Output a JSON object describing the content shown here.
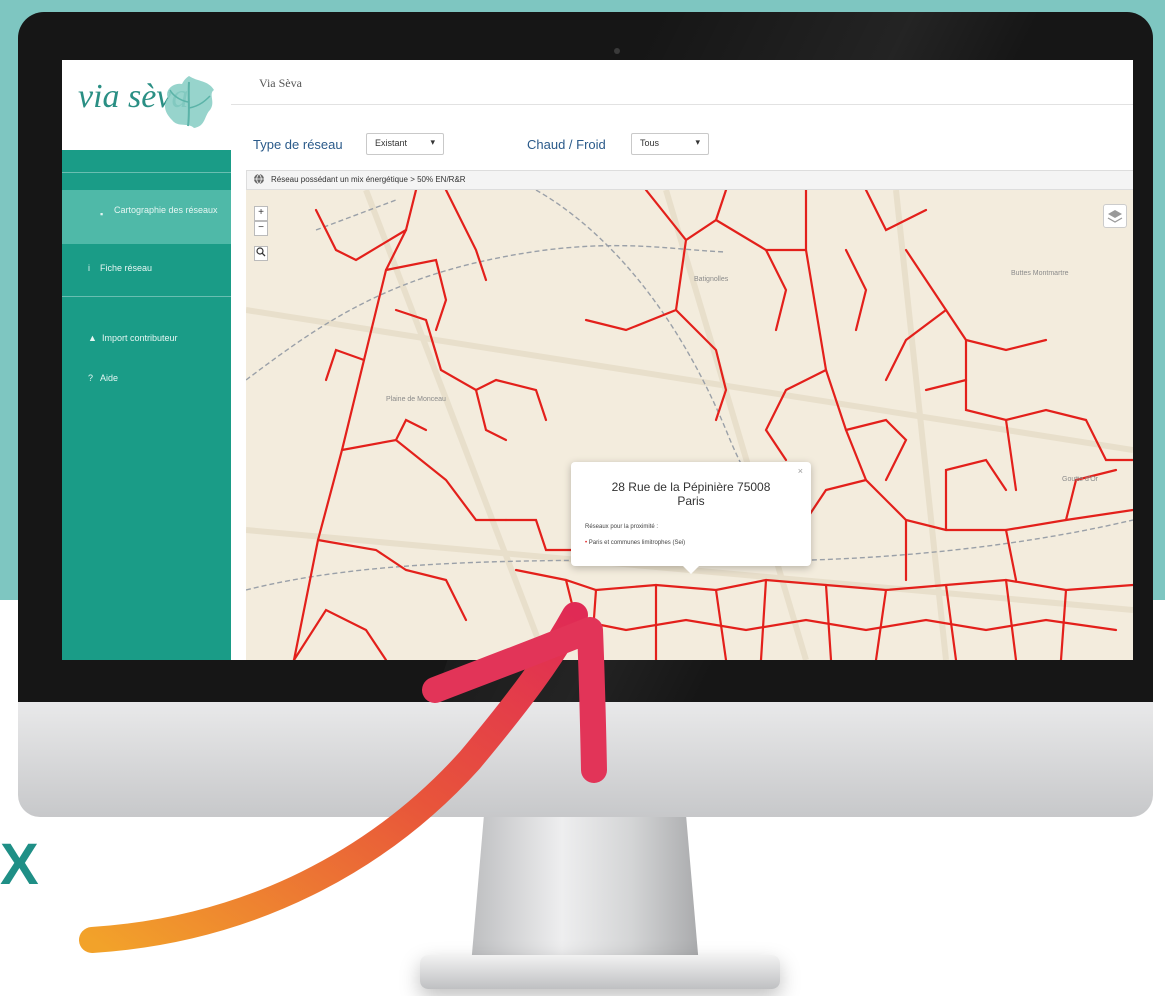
{
  "app": {
    "logo_text": "via sèva",
    "title": "Via Sèva"
  },
  "sidebar": {
    "items": [
      {
        "label": "Cartographie des réseaux",
        "icon": "map-icon",
        "active": true
      },
      {
        "label": "Fiche réseau",
        "icon": "info-icon"
      },
      {
        "label": "Import contributeur",
        "icon": "user-icon"
      },
      {
        "label": "Aide",
        "icon": "help-icon"
      }
    ]
  },
  "filters": {
    "type_label": "Type de réseau",
    "type_value": "Existant",
    "chaud_label": "Chaud / Froid",
    "chaud_value": "Tous"
  },
  "legend": {
    "text": "Réseau possédant un mix énergétique > 50% EN/R&R"
  },
  "map": {
    "zoom_in": "+",
    "zoom_out": "−",
    "search": "🔍",
    "labels": {
      "a": "Batignolles",
      "b": "Buttes Montmartre",
      "c": "Plaine de Monceau",
      "d": "Goutte d'Or"
    },
    "network_color": "#e3201b"
  },
  "popup": {
    "close": "×",
    "address_line1": "28 Rue de la Pépinière 75008",
    "address_line2": "Paris",
    "subtitle": "Réseaux pour la proximité :",
    "item": "Paris et communes limitrophes (Sei)"
  },
  "decor": {
    "x_letter": "X"
  },
  "colors": {
    "teal_bg": "#7ec6c1",
    "sidebar": "#1a9c87",
    "sidebar_active": "#4fb9a8",
    "network": "#e3201b",
    "arrow_start": "#f2a22a",
    "arrow_end": "#e02a55"
  }
}
